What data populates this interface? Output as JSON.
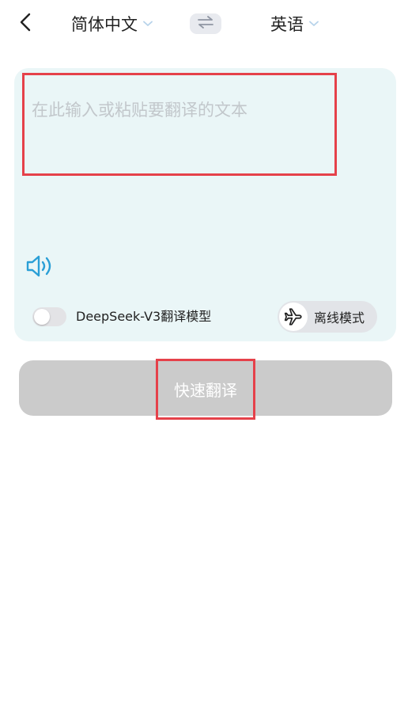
{
  "header": {
    "source_language": "简体中文",
    "target_language": "英语",
    "back_icon": "chevron-left-icon",
    "swap_icon": "swap-arrows-icon",
    "dropdown_icon": "chevron-down-icon"
  },
  "input": {
    "value": "",
    "placeholder": "在此输入或粘贴要翻译的文本"
  },
  "speaker_icon": "speaker-volume-icon",
  "model_toggle": {
    "label": "DeepSeek-V3翻译模型",
    "checked": false
  },
  "offline_mode": {
    "label": "离线模式",
    "icon": "airplane-icon"
  },
  "translate_button": {
    "label": "快速翻译"
  },
  "colors": {
    "card_background": "#eaf6f7",
    "highlight_border": "#e5414a",
    "button_disabled": "#cbcbcb",
    "accent_blue": "#2a9fd6",
    "dropdown_chevron": "#b7d3ea"
  }
}
